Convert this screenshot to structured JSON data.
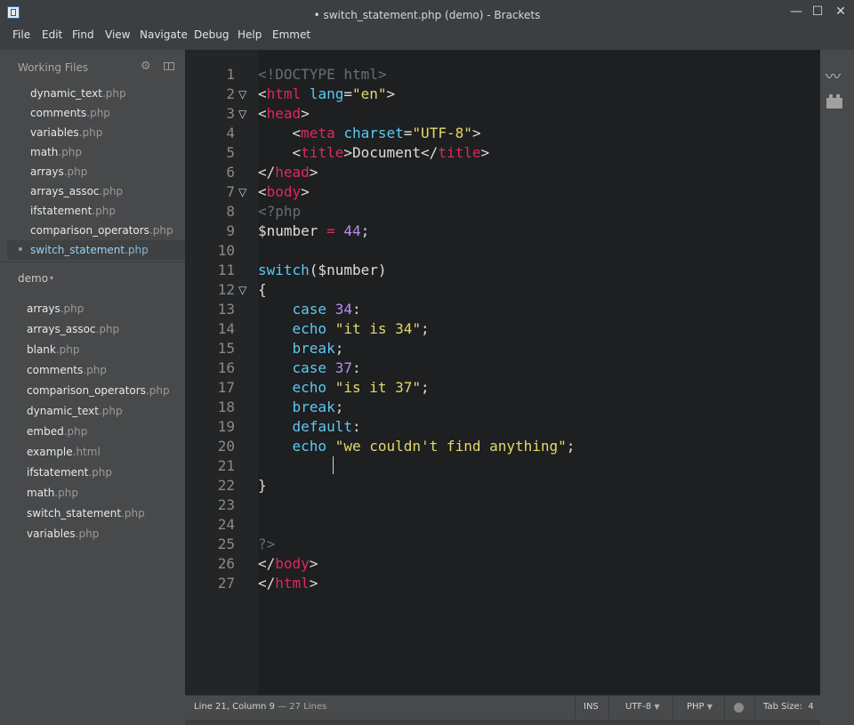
{
  "window": {
    "title": "• switch_statement.php (demo) - Brackets",
    "min": "—",
    "max": "☐",
    "close": "✕"
  },
  "menu": [
    "File",
    "Edit",
    "Find",
    "View",
    "Navigate",
    "Debug",
    "Help",
    "Emmet"
  ],
  "working_files": {
    "header": "Working Files",
    "gear": "⚙",
    "items": [
      {
        "name": "dynamic_text",
        "ext": ".php"
      },
      {
        "name": "comments",
        "ext": ".php"
      },
      {
        "name": "variables",
        "ext": ".php"
      },
      {
        "name": "math",
        "ext": ".php"
      },
      {
        "name": "arrays",
        "ext": ".php"
      },
      {
        "name": "arrays_assoc",
        "ext": ".php"
      },
      {
        "name": "ifstatement",
        "ext": ".php"
      },
      {
        "name": "comparison_operators",
        "ext": ".php"
      },
      {
        "name": "switch_statement",
        "ext": ".php"
      }
    ]
  },
  "project": {
    "title": "demo",
    "caret": "▾",
    "items": [
      {
        "name": "arrays",
        "ext": ".php"
      },
      {
        "name": "arrays_assoc",
        "ext": ".php"
      },
      {
        "name": "blank",
        "ext": ".php"
      },
      {
        "name": "comments",
        "ext": ".php"
      },
      {
        "name": "comparison_operators",
        "ext": ".php"
      },
      {
        "name": "dynamic_text",
        "ext": ".php"
      },
      {
        "name": "embed",
        "ext": ".php"
      },
      {
        "name": "example",
        "ext": ".html"
      },
      {
        "name": "ifstatement",
        "ext": ".php"
      },
      {
        "name": "math",
        "ext": ".php"
      },
      {
        "name": "switch_statement",
        "ext": ".php"
      },
      {
        "name": "variables",
        "ext": ".php"
      }
    ]
  },
  "editor": {
    "fold_marker": "▽",
    "lines": [
      {
        "n": "1",
        "t": [
          [
            "com",
            "<!DOCTYPE html>"
          ]
        ]
      },
      {
        "n": "2",
        "fold": true,
        "t": [
          [
            "br",
            "<"
          ],
          [
            "tag",
            "html"
          ],
          [
            "br",
            " "
          ],
          [
            "attr",
            "lang"
          ],
          [
            "br",
            "="
          ],
          [
            "str",
            "\"en\""
          ],
          [
            "br",
            ">"
          ]
        ]
      },
      {
        "n": "3",
        "fold": true,
        "t": [
          [
            "br",
            "<"
          ],
          [
            "tag",
            "head"
          ],
          [
            "br",
            ">"
          ]
        ]
      },
      {
        "n": "4",
        "t": [
          [
            "br",
            "    <"
          ],
          [
            "tag",
            "meta"
          ],
          [
            "br",
            " "
          ],
          [
            "attr",
            "charset"
          ],
          [
            "br",
            "="
          ],
          [
            "str",
            "\"UTF-8\""
          ],
          [
            "br",
            ">"
          ]
        ]
      },
      {
        "n": "5",
        "t": [
          [
            "br",
            "    <"
          ],
          [
            "tag",
            "title"
          ],
          [
            "br",
            ">Document</"
          ],
          [
            "tag",
            "title"
          ],
          [
            "br",
            ">"
          ]
        ]
      },
      {
        "n": "6",
        "t": [
          [
            "br",
            "</"
          ],
          [
            "tag",
            "head"
          ],
          [
            "br",
            ">"
          ]
        ]
      },
      {
        "n": "7",
        "fold": true,
        "t": [
          [
            "br",
            "<"
          ],
          [
            "tag",
            "body"
          ],
          [
            "br",
            ">"
          ]
        ]
      },
      {
        "n": "8",
        "t": [
          [
            "com",
            "<?php"
          ]
        ]
      },
      {
        "n": "9",
        "t": [
          [
            "br",
            "$number "
          ],
          [
            "op",
            "="
          ],
          [
            "br",
            " "
          ],
          [
            "num",
            "44"
          ],
          [
            "br",
            ";"
          ]
        ]
      },
      {
        "n": "10",
        "t": []
      },
      {
        "n": "11",
        "t": [
          [
            "kw",
            "switch"
          ],
          [
            "br",
            "($number)"
          ]
        ]
      },
      {
        "n": "12",
        "fold": true,
        "t": [
          [
            "br",
            "{"
          ]
        ]
      },
      {
        "n": "13",
        "t": [
          [
            "br",
            "    "
          ],
          [
            "kw",
            "case"
          ],
          [
            "br",
            " "
          ],
          [
            "num",
            "34"
          ],
          [
            "br",
            ":"
          ]
        ]
      },
      {
        "n": "14",
        "t": [
          [
            "br",
            "    "
          ],
          [
            "kw",
            "echo"
          ],
          [
            "br",
            " "
          ],
          [
            "str",
            "\"it is 34\""
          ],
          [
            "br",
            ";"
          ]
        ]
      },
      {
        "n": "15",
        "t": [
          [
            "br",
            "    "
          ],
          [
            "kw",
            "break"
          ],
          [
            "br",
            ";"
          ]
        ]
      },
      {
        "n": "16",
        "t": [
          [
            "br",
            "    "
          ],
          [
            "kw",
            "case"
          ],
          [
            "br",
            " "
          ],
          [
            "num",
            "37"
          ],
          [
            "br",
            ":"
          ]
        ]
      },
      {
        "n": "17",
        "t": [
          [
            "br",
            "    "
          ],
          [
            "kw",
            "echo"
          ],
          [
            "br",
            " "
          ],
          [
            "str",
            "\"is it 37\""
          ],
          [
            "br",
            ";"
          ]
        ]
      },
      {
        "n": "18",
        "t": [
          [
            "br",
            "    "
          ],
          [
            "kw",
            "break"
          ],
          [
            "br",
            ";"
          ]
        ]
      },
      {
        "n": "19",
        "t": [
          [
            "br",
            "    "
          ],
          [
            "kw",
            "default"
          ],
          [
            "br",
            ":"
          ]
        ]
      },
      {
        "n": "20",
        "t": [
          [
            "br",
            "    "
          ],
          [
            "kw",
            "echo"
          ],
          [
            "br",
            " "
          ],
          [
            "str",
            "\"we couldn't find anything\""
          ],
          [
            "br",
            ";"
          ]
        ]
      },
      {
        "n": "21",
        "t": []
      },
      {
        "n": "22",
        "t": [
          [
            "br",
            "}"
          ]
        ]
      },
      {
        "n": "23",
        "t": []
      },
      {
        "n": "24",
        "t": []
      },
      {
        "n": "25",
        "t": [
          [
            "com",
            "?>"
          ]
        ]
      },
      {
        "n": "26",
        "t": [
          [
            "br",
            "</"
          ],
          [
            "tag",
            "body"
          ],
          [
            "br",
            ">"
          ]
        ]
      },
      {
        "n": "27",
        "t": [
          [
            "br",
            "</"
          ],
          [
            "tag",
            "html"
          ],
          [
            "br",
            ">"
          ]
        ]
      }
    ]
  },
  "status": {
    "position": "Line 21, Column 9",
    "lines": " — 27 Lines",
    "ins": "INS",
    "encoding": "UTF-8",
    "language": "PHP",
    "tabsize_label": "Tab Size:",
    "tabsize_value": "4",
    "caret": "▼"
  },
  "icons": {
    "app": "brackets-logo-icon",
    "gear": "gear-icon",
    "split": "split-view-icon",
    "live": "live-preview-icon",
    "ext": "extension-manager-icon",
    "lint": "linter-status-icon"
  },
  "colors": {
    "tag": "#e2275f",
    "attr": "#5ec8f0",
    "string": "#e6d96a",
    "number": "#b98df0",
    "comment": "#6b6e70",
    "editor_bg": "#1d1f21",
    "sidebar_bg": "#47494b"
  }
}
